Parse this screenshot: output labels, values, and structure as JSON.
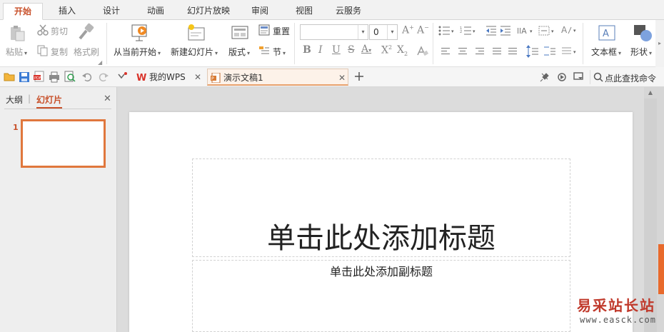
{
  "ribbon_tabs": [
    "开始",
    "插入",
    "设计",
    "动画",
    "幻灯片放映",
    "审阅",
    "视图",
    "云服务"
  ],
  "active_tab": "开始",
  "clipboard": {
    "paste": "粘贴",
    "cut": "剪切",
    "copy": "复制",
    "format_painter": "格式刷"
  },
  "slides_group": {
    "play_from_current": "从当前开始",
    "new_slide": "新建幻灯片",
    "layout": "版式",
    "reset": "重置",
    "section": "节"
  },
  "font": {
    "name": "",
    "size": "0"
  },
  "insert_group": {
    "textbox": "文本框",
    "shape": "形状"
  },
  "doc_tabs": [
    {
      "label": "我的WPS",
      "active": false
    },
    {
      "label": "演示文稿1",
      "active": true
    }
  ],
  "search": {
    "label": "点此查找命令"
  },
  "panel": {
    "outline_tab": "大纲",
    "separator": "|",
    "slides_tab": "幻灯片"
  },
  "thumbnail": {
    "number": "1"
  },
  "slide": {
    "title_placeholder": "单击此处添加标题",
    "subtitle_placeholder": "单击此处添加副标题"
  },
  "watermark": {
    "chinese": "易采站长站",
    "url": "www.easck.com"
  },
  "colors": {
    "accent": "#c8502a",
    "selection": "#e0773d",
    "scroll_thumb": "#e86a2c",
    "watermark": "#c0392b"
  }
}
